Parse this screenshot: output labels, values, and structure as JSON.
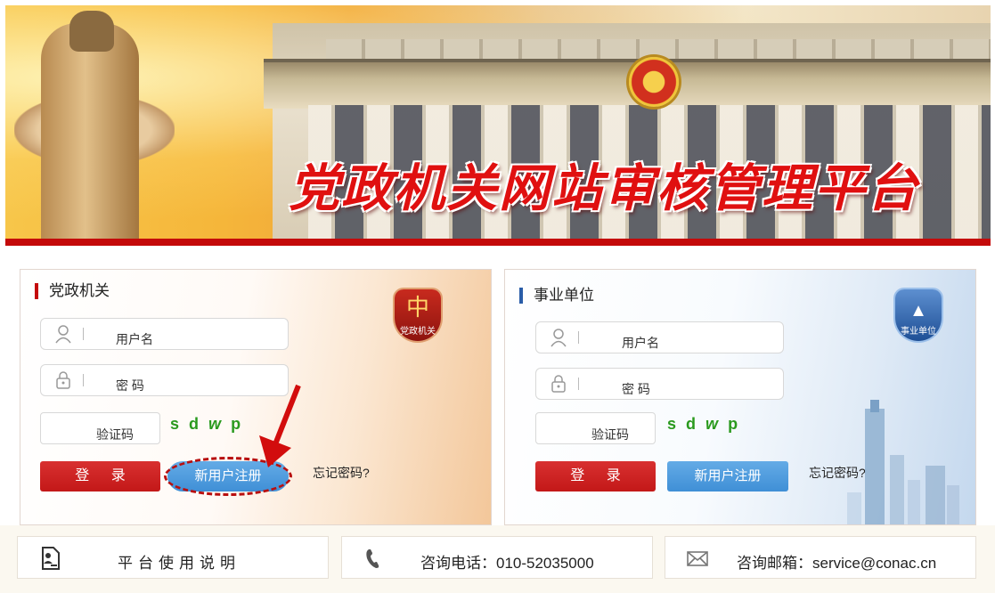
{
  "banner": {
    "title": "党政机关网站审核管理平台"
  },
  "panel_left": {
    "title": "党政机关",
    "badge": "党政机关",
    "username_placeholder": "用户名",
    "password_placeholder": "密 码",
    "captcha_placeholder": "验证码",
    "captcha_text": [
      "s",
      "d",
      "w",
      "p"
    ],
    "login_label": "登 录",
    "register_label": "新用户注册",
    "forgot_label": "忘记密码?"
  },
  "panel_right": {
    "title": "事业单位",
    "badge": "事业单位",
    "username_placeholder": "用户名",
    "password_placeholder": "密 码",
    "captcha_placeholder": "验证码",
    "captcha_text": [
      "s",
      "d",
      "w",
      "p"
    ],
    "login_label": "登 录",
    "register_label": "新用户注册",
    "forgot_label": "忘记密码?"
  },
  "info": {
    "guide": "平台使用说明",
    "phone": "咨询电话：010-52035000",
    "mail": "咨询邮箱：service@conac.cn"
  },
  "colors": {
    "accent_red": "#c40a0a",
    "accent_blue": "#4a98dc",
    "captcha_green": "#2a9a1e"
  },
  "icons": [
    "user-icon",
    "lock-icon",
    "document-user-icon",
    "phone-icon",
    "mail-icon"
  ]
}
